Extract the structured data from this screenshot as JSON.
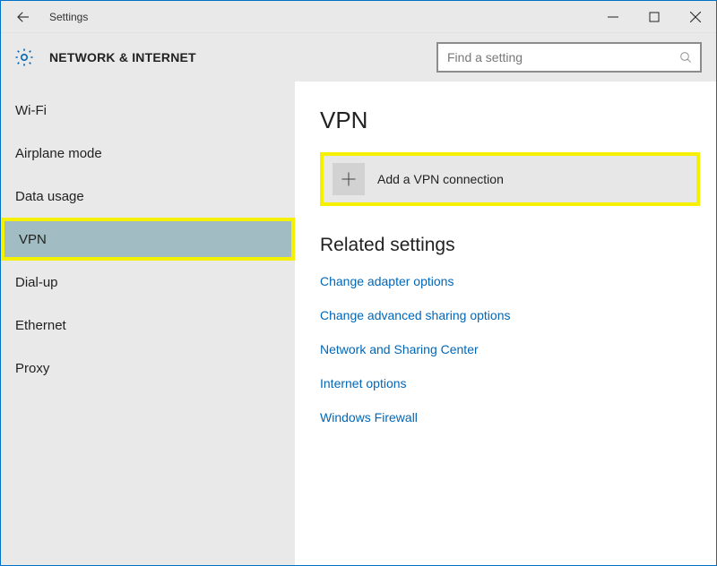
{
  "window": {
    "title": "Settings"
  },
  "header": {
    "category": "NETWORK & INTERNET",
    "search_placeholder": "Find a setting"
  },
  "sidebar": {
    "items": [
      {
        "label": "Wi-Fi",
        "selected": false
      },
      {
        "label": "Airplane mode",
        "selected": false
      },
      {
        "label": "Data usage",
        "selected": false
      },
      {
        "label": "VPN",
        "selected": true
      },
      {
        "label": "Dial-up",
        "selected": false
      },
      {
        "label": "Ethernet",
        "selected": false
      },
      {
        "label": "Proxy",
        "selected": false
      }
    ]
  },
  "content": {
    "page_title": "VPN",
    "add_vpn_label": "Add a VPN connection",
    "related_title": "Related settings",
    "links": [
      "Change adapter options",
      "Change advanced sharing options",
      "Network and Sharing Center",
      "Internet options",
      "Windows Firewall"
    ]
  }
}
